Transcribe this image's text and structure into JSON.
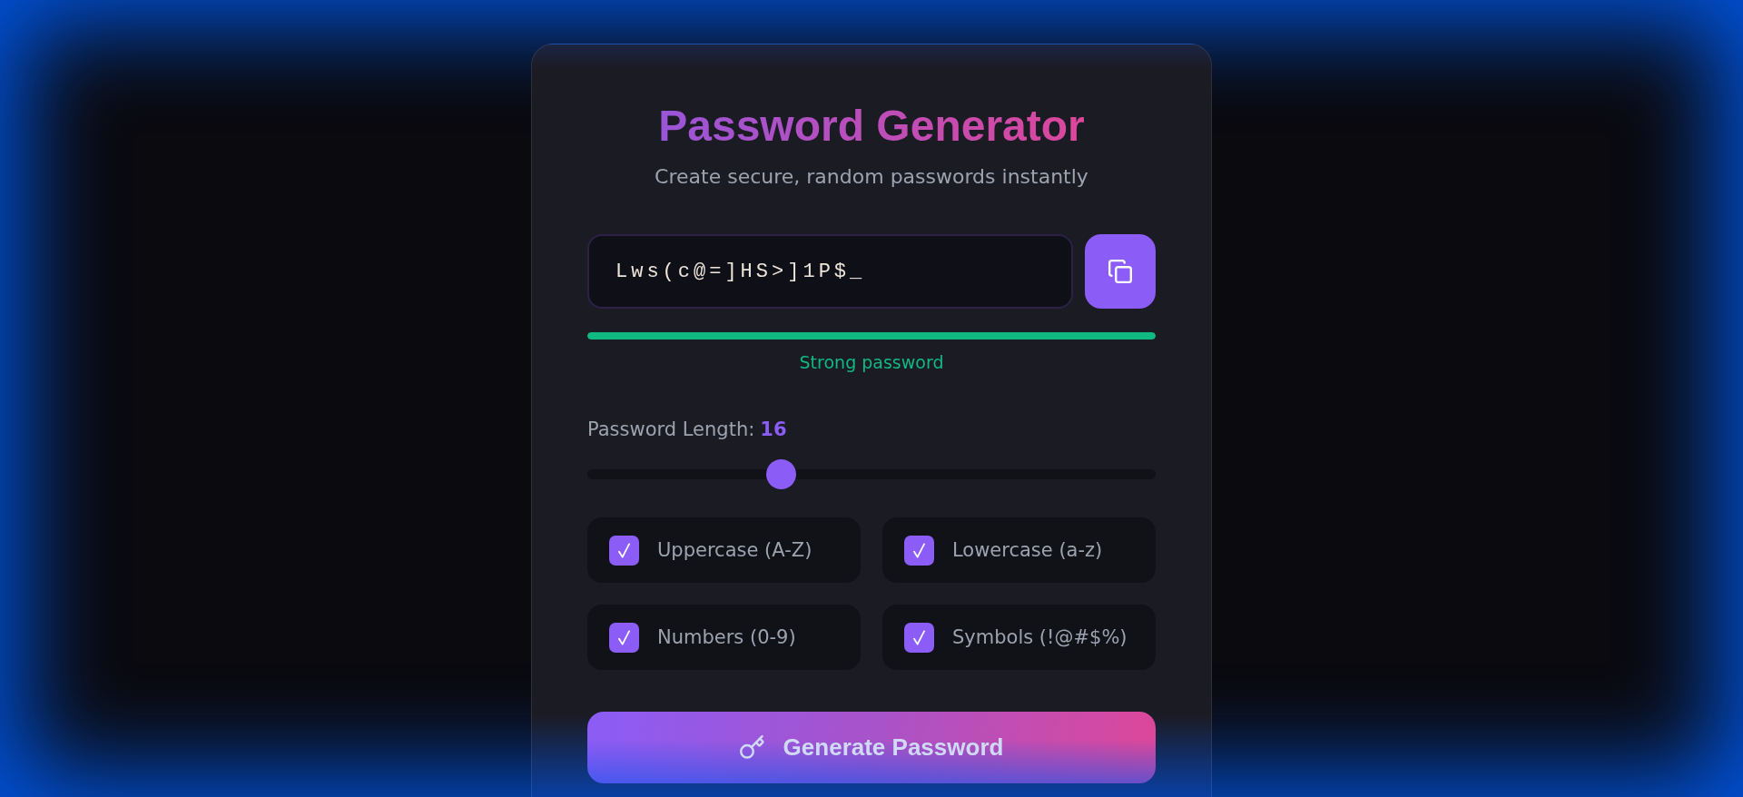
{
  "header": {
    "title": "Password Generator",
    "subtitle": "Create secure, random passwords instantly"
  },
  "password": {
    "value": "Lws(c@=]HS>]1P$_"
  },
  "strength": {
    "level": 1,
    "label": "Strong password"
  },
  "length": {
    "label": "Password Length:",
    "value": "16",
    "level": 0.333
  },
  "options": [
    {
      "label": "Uppercase (A-Z)",
      "checked": true
    },
    {
      "label": "Lowercase (a-z)",
      "checked": true
    },
    {
      "label": "Numbers (0-9)",
      "checked": true
    },
    {
      "label": "Symbols (!@#$%)",
      "checked": true
    }
  ],
  "generate_button": {
    "label": "Generate Password"
  }
}
